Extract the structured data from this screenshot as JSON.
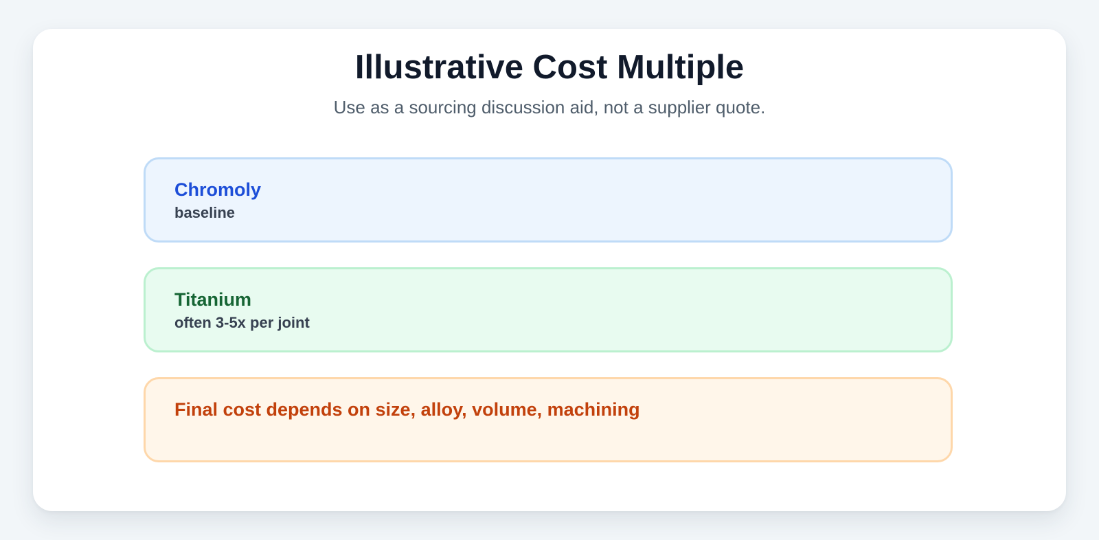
{
  "header": {
    "title": "Illustrative Cost Multiple",
    "subtitle": "Use as a sourcing discussion aid, not a supplier quote."
  },
  "panels": [
    {
      "title": "Chromoly",
      "text": "baseline",
      "title_color": "#1d4ed8",
      "background": "#edf5fe",
      "border": "#bfdbf7"
    },
    {
      "title": "Titanium",
      "text": "often 3-5x per joint",
      "title_color": "#166534",
      "background": "#e8fbf0",
      "border": "#bbf0cf"
    },
    {
      "title": "Final cost depends on size, alloy, volume, machining",
      "title_color": "#c2410c",
      "background": "#fff6ea",
      "border": "#fed7aa"
    }
  ]
}
